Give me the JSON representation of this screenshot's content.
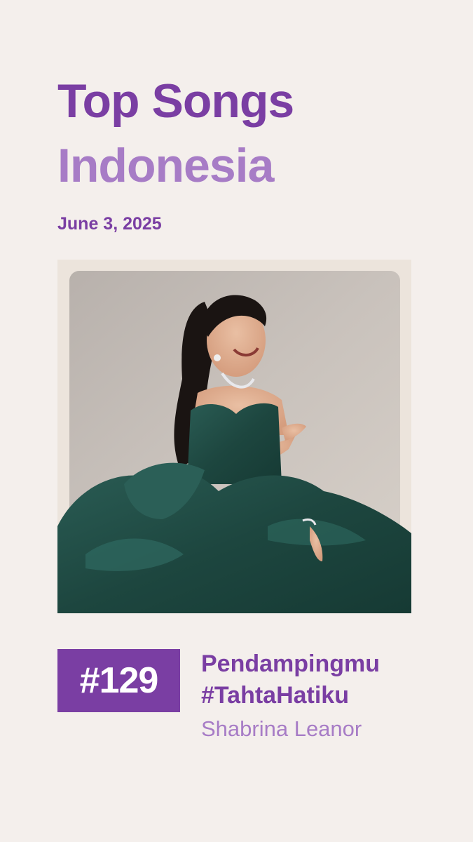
{
  "header": {
    "title_line1": "Top Songs",
    "title_line2": "Indonesia",
    "date": "June 3, 2025"
  },
  "colors": {
    "background": "#f4efec",
    "primary_purple": "#7a3ea3",
    "light_purple": "#a77cc6",
    "dress_green": "#1f4a44"
  },
  "photo": {
    "subject": "artist-portrait"
  },
  "entry": {
    "rank": "#129",
    "song_title_line1": "Pendampingmu",
    "song_title_line2": "#TahtaHatiku",
    "artist": "Shabrina Leanor"
  }
}
